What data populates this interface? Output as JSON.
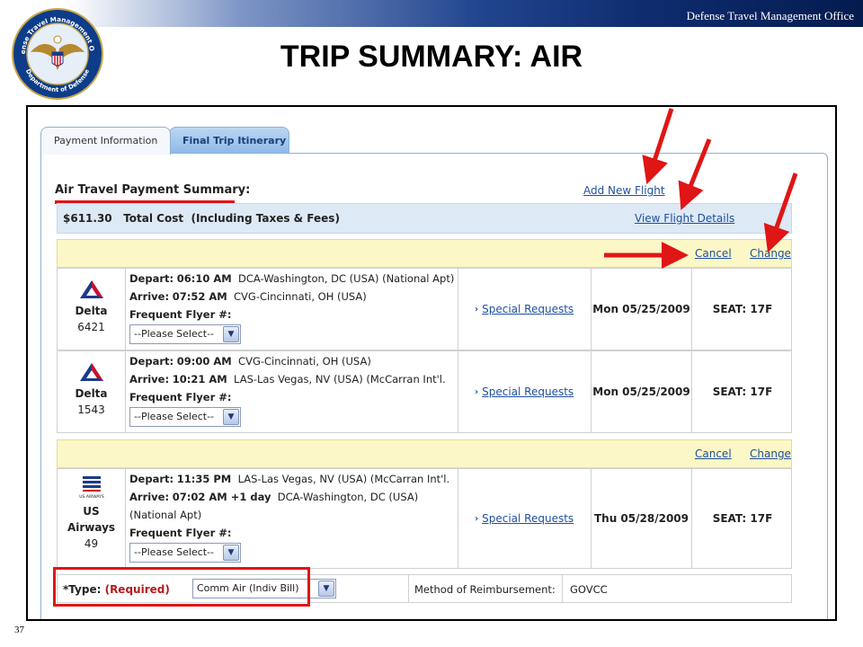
{
  "slide": {
    "office": "Defense Travel Management Office",
    "title": "TRIP SUMMARY: AIR",
    "page_number": "37",
    "seal_text_top": "Defense Travel Management Office",
    "seal_text_bottom": "Department of Defense"
  },
  "tabs": [
    {
      "label": "Payment Information",
      "active": true
    },
    {
      "label": "Final Trip Itinerary",
      "active": false
    }
  ],
  "summary": {
    "title": "Air Travel Payment Summary:",
    "add_flight": "Add New Flight",
    "total_amount": "$611.30",
    "total_label": "Total Cost",
    "total_note": "(Including Taxes & Fees)",
    "view_details": "View Flight Details"
  },
  "segment_actions": {
    "cancel": "Cancel",
    "change": "Change"
  },
  "legs": [
    {
      "airline": "Delta",
      "flight": "6421",
      "logo": "delta-logo",
      "depart_label": "Depart:",
      "depart_time": "06:10 AM",
      "depart_place": "DCA-Washington, DC (USA) (National Apt)",
      "arrive_label": "Arrive:",
      "arrive_time": "07:52 AM",
      "arrive_place": "CVG-Cincinnati, OH (USA)",
      "ff_label": "Frequent Flyer #:",
      "ff_select": "--Please Select--",
      "special": "Special Requests",
      "date": "Mon 05/25/2009",
      "seat": "SEAT: 17F"
    },
    {
      "airline": "Delta",
      "flight": "1543",
      "logo": "delta-logo",
      "depart_label": "Depart:",
      "depart_time": "09:00 AM",
      "depart_place": "CVG-Cincinnati, OH (USA)",
      "arrive_label": "Arrive:",
      "arrive_time": "10:21 AM",
      "arrive_place": "LAS-Las Vegas, NV (USA) (McCarran Int'l.",
      "ff_label": "Frequent Flyer #:",
      "ff_select": "--Please Select--",
      "special": "Special Requests",
      "date": "Mon 05/25/2009",
      "seat": "SEAT: 17F"
    },
    {
      "airline": "US",
      "airline_2": "Airways",
      "flight": "49",
      "logo": "us-airways-logo",
      "logo_caption": "US AIRWAYS",
      "depart_label": "Depart:",
      "depart_time": "11:35 PM",
      "depart_place": "LAS-Las Vegas, NV (USA) (McCarran Int'l.",
      "arrive_label": "Arrive:",
      "arrive_time": "07:02 AM +1 day",
      "arrive_place": "DCA-Washington, DC (USA)",
      "arrive_place_2": "(National Apt)",
      "ff_label": "Frequent Flyer #:",
      "ff_select": "--Please Select--",
      "special": "Special Requests",
      "date": "Thu 05/28/2009",
      "seat": "SEAT: 17F"
    }
  ],
  "type_row": {
    "label": "*Type:",
    "required": "(Required)",
    "select": "Comm Air (Indiv Bill)",
    "reimb_label": "Method of Reimbursement:",
    "reimb_value": "GOVCC"
  },
  "colors": {
    "annotation_red": "#e01515",
    "link_blue": "#1f4f9e",
    "segment_header": "#fcf7c6",
    "total_bar": "#dde9f5",
    "delta_red": "#c8102e",
    "delta_navy": "#1b3a8a"
  }
}
